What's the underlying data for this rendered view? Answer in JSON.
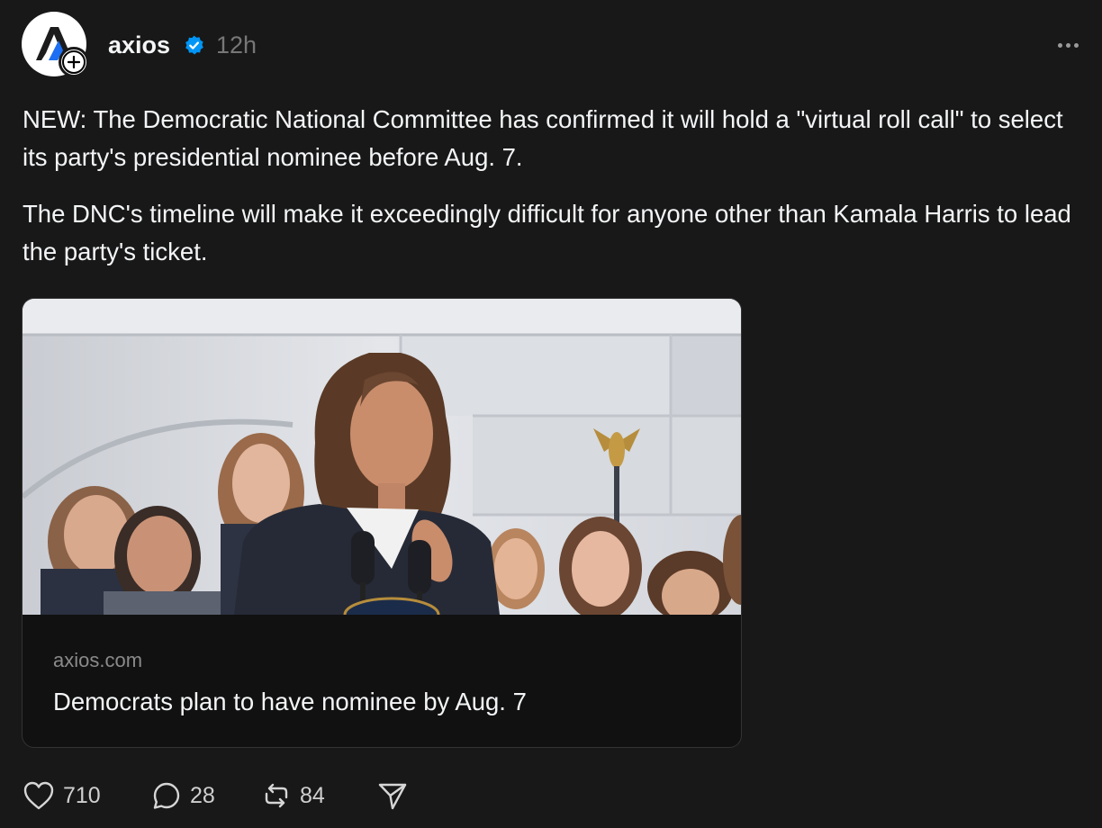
{
  "post": {
    "author": "axios",
    "verified": true,
    "timestamp": "12h",
    "paragraphs": [
      "NEW: The Democratic National Committee has confirmed it will hold a \"virtual roll call\" to select its party's presidential nominee before Aug. 7.",
      "The DNC's timeline will make it exceedingly difficult for anyone other than Kamala Harris to lead the party's ticket."
    ],
    "link_card": {
      "domain": "axios.com",
      "title": "Democrats plan to have nominee by Aug. 7"
    },
    "actions": {
      "likes": "710",
      "replies": "28",
      "reposts": "84"
    }
  },
  "colors": {
    "background": "#181818",
    "text": "#f3f5f7",
    "muted": "#777777",
    "verified_blue": "#0095f6",
    "card_bg": "#111111"
  },
  "icons": {
    "verified": "verified-badge-icon",
    "more": "more-horizontal-icon",
    "like": "heart-icon",
    "reply": "speech-bubble-icon",
    "repost": "repost-icon",
    "share": "send-icon",
    "follow": "plus-icon"
  }
}
